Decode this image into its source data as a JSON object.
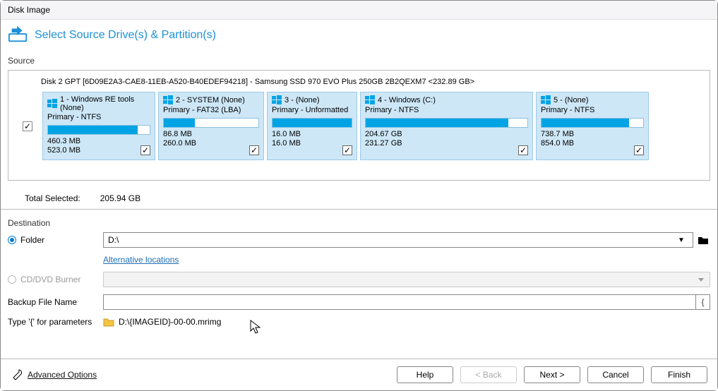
{
  "window": {
    "title": "Disk Image"
  },
  "header": {
    "title": "Select Source Drive(s) & Partition(s)"
  },
  "source": {
    "label": "Source",
    "disk_header": "Disk 2 GPT [6D09E2A3-CAE8-11EB-A520-B40EDEF94218] - Samsung SSD 970 EVO Plus 250GB 2B2QEXM7  <232.89 GB>",
    "partitions": [
      {
        "title": "1 - Windows RE tools (None)",
        "sub": "Primary - NTFS",
        "used": "460.3 MB",
        "total": "523.0 MB",
        "fill": 88
      },
      {
        "title": "2 - SYSTEM (None)",
        "sub": "Primary - FAT32 (LBA)",
        "used": "86.8 MB",
        "total": "260.0 MB",
        "fill": 33
      },
      {
        "title": "3 -  (None)",
        "sub": "Primary - Unformatted",
        "used": "16.0 MB",
        "total": "16.0 MB",
        "fill": 100
      },
      {
        "title": "4 - Windows (C:)",
        "sub": "Primary - NTFS",
        "used": "204.67 GB",
        "total": "231.27 GB",
        "fill": 88
      },
      {
        "title": "5 -  (None)",
        "sub": "Primary - NTFS",
        "used": "738.7 MB",
        "total": "854.0 MB",
        "fill": 86
      }
    ],
    "total_label": "Total Selected:",
    "total_value": "205.94 GB"
  },
  "destination": {
    "label": "Destination",
    "folder_label": "Folder",
    "folder_value": "D:\\",
    "alt_locations": "Alternative locations",
    "burner_label": "CD/DVD Burner",
    "file_label": "Backup File Name",
    "file_value": "",
    "hint_label": "Type '{' for parameters",
    "preview": "D:\\{IMAGEID}-00-00.mrimg"
  },
  "footer": {
    "advanced": "Advanced Options",
    "help": "Help",
    "back": "< Back",
    "next": "Next >",
    "cancel": "Cancel",
    "finish": "Finish"
  }
}
